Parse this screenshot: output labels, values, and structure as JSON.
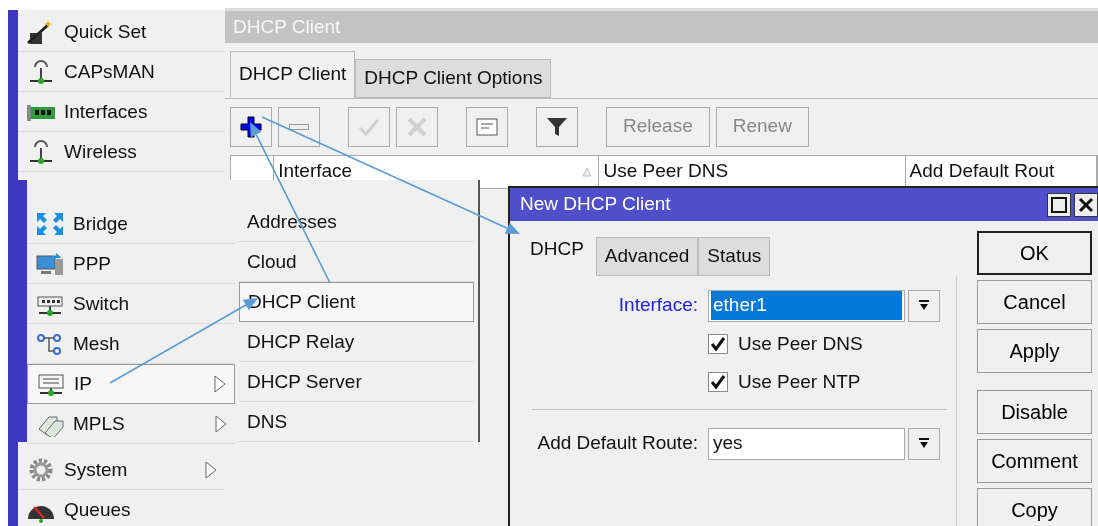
{
  "main_menu": {
    "items": [
      {
        "label": "Quick Set",
        "has_submenu": false
      },
      {
        "label": "CAPsMAN",
        "has_submenu": false
      },
      {
        "label": "Interfaces",
        "has_submenu": false
      },
      {
        "label": "Wireless",
        "has_submenu": false
      },
      {
        "label": "System",
        "has_submenu": true
      },
      {
        "label": "Queues",
        "has_submenu": false
      }
    ]
  },
  "front_menu": {
    "items": [
      {
        "label": "Bridge",
        "has_submenu": false,
        "selected": false
      },
      {
        "label": "PPP",
        "has_submenu": false,
        "selected": false
      },
      {
        "label": "Switch",
        "has_submenu": false,
        "selected": false
      },
      {
        "label": "Mesh",
        "has_submenu": false,
        "selected": false
      },
      {
        "label": "IP",
        "has_submenu": true,
        "selected": true
      },
      {
        "label": "MPLS",
        "has_submenu": true,
        "selected": false
      }
    ]
  },
  "ip_submenu": {
    "items": [
      {
        "label": "Addresses",
        "selected": false
      },
      {
        "label": "Cloud",
        "selected": false
      },
      {
        "label": "DHCP Client",
        "selected": true
      },
      {
        "label": "DHCP Relay",
        "selected": false
      },
      {
        "label": "DHCP Server",
        "selected": false
      },
      {
        "label": "DNS",
        "selected": false
      }
    ]
  },
  "dhcp_window": {
    "title": "DHCP Client",
    "tabs": [
      {
        "label": "DHCP Client",
        "selected": true
      },
      {
        "label": "DHCP Client Options",
        "selected": false
      }
    ],
    "toolbar": [
      {
        "kind": "add",
        "disabled": false
      },
      {
        "kind": "remove",
        "disabled": false
      },
      {
        "kind": "enable",
        "disabled": true
      },
      {
        "kind": "disable",
        "disabled": true
      },
      {
        "kind": "comment",
        "disabled": false
      },
      {
        "kind": "filter",
        "disabled": false
      },
      {
        "kind": "text",
        "label": "Release",
        "disabled": true
      },
      {
        "kind": "text",
        "label": "Renew",
        "disabled": true
      }
    ],
    "table": {
      "columns": [
        "Interface",
        "Use Peer DNS",
        "Add Default Rout"
      ]
    }
  },
  "dialog": {
    "title": "New DHCP Client",
    "tabs": [
      {
        "label": "DHCP",
        "selected": true
      },
      {
        "label": "Advanced",
        "selected": false
      },
      {
        "label": "Status",
        "selected": false
      }
    ],
    "fields": [
      {
        "kind": "select",
        "label": "Interface:",
        "value": "ether1",
        "highlighted": true
      },
      {
        "kind": "checkbox",
        "label": "Use Peer DNS",
        "checked": true
      },
      {
        "kind": "checkbox",
        "label": "Use Peer NTP",
        "checked": true
      },
      {
        "kind": "separator"
      },
      {
        "kind": "select",
        "label": "Add Default Route:",
        "value": "yes",
        "highlighted": false
      }
    ],
    "buttons": [
      {
        "label": "OK",
        "default": true
      },
      {
        "label": "Cancel",
        "default": false
      },
      {
        "label": "Apply",
        "default": false
      }
    ],
    "more_buttons": [
      {
        "label": "Disable",
        "default": false
      },
      {
        "label": "Comment",
        "default": false
      },
      {
        "label": "Copy",
        "default": false
      }
    ]
  }
}
